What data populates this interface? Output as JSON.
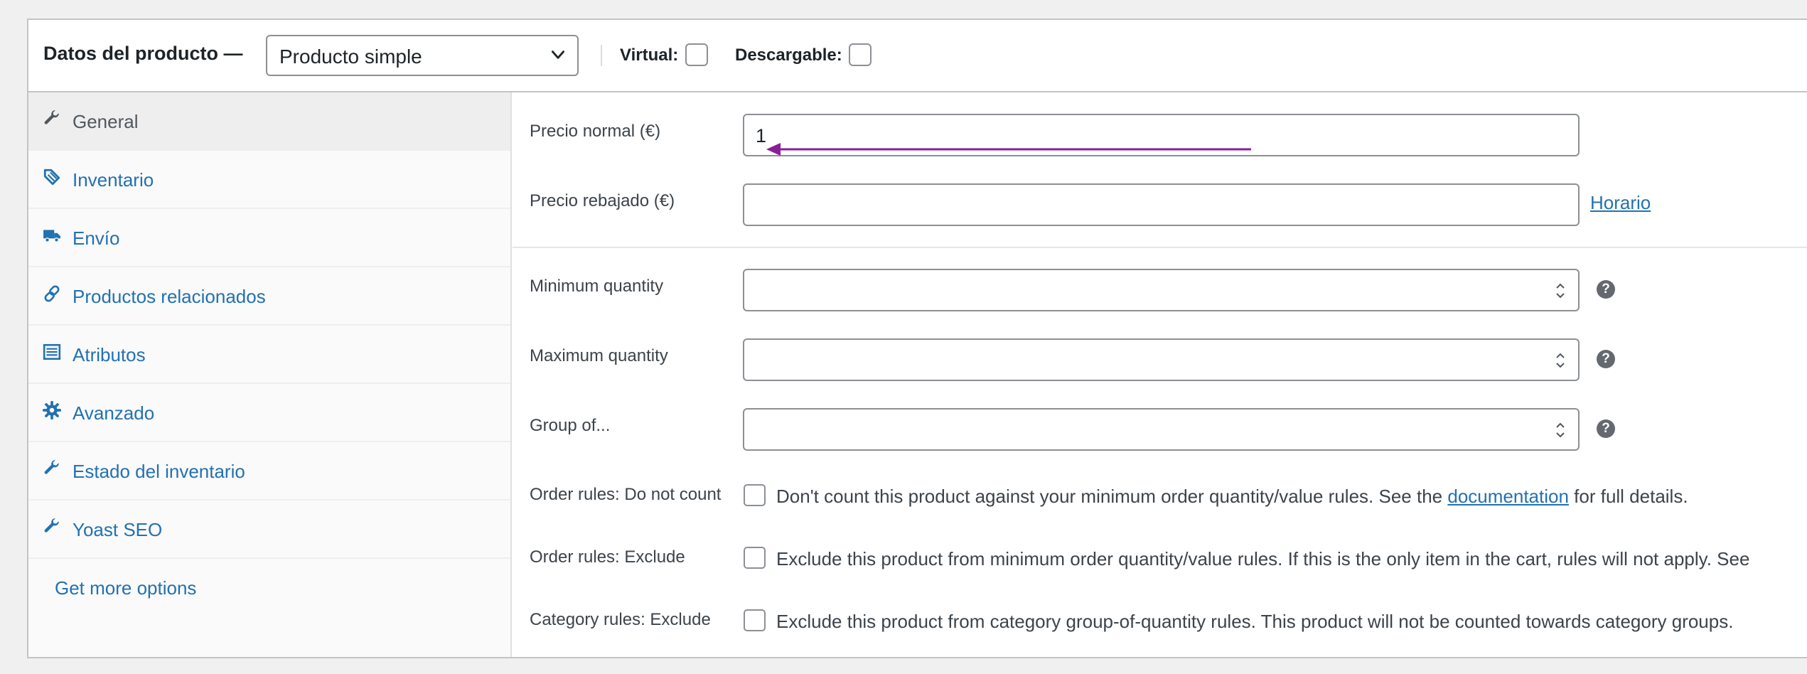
{
  "header": {
    "title": "Datos del producto —",
    "product_type": "Producto simple",
    "virtual_label": "Virtual:",
    "downloadable_label": "Descargable:"
  },
  "sidebar": {
    "items": [
      {
        "label": "General",
        "icon": "wrench-icon",
        "active": true
      },
      {
        "label": "Inventario",
        "icon": "tag-icon"
      },
      {
        "label": "Envío",
        "icon": "truck-icon"
      },
      {
        "label": "Productos relacionados",
        "icon": "link-icon"
      },
      {
        "label": "Atributos",
        "icon": "list-icon"
      },
      {
        "label": "Avanzado",
        "icon": "gear-icon"
      },
      {
        "label": "Estado del inventario",
        "icon": "wrench-icon"
      },
      {
        "label": "Yoast SEO",
        "icon": "wrench-icon"
      }
    ],
    "more_options": "Get more options"
  },
  "pricing": {
    "regular_price_label": "Precio normal (€)",
    "regular_price_value": "1",
    "sale_price_label": "Precio rebajado (€)",
    "sale_price_value": "",
    "schedule_link": "Horario"
  },
  "quantity": {
    "min_label": "Minimum quantity",
    "max_label": "Maximum quantity",
    "group_label": "Group of...",
    "help_glyph": "?"
  },
  "rules": {
    "do_not_count_label": "Order rules: Do not count",
    "do_not_count_text_before": "Don't count this product against your minimum order quantity/value rules. See the",
    "do_not_count_link": "documentation",
    "do_not_count_text_after": "for full details.",
    "exclude_label": "Order rules: Exclude",
    "exclude_text": "Exclude this product from minimum order quantity/value rules. If this is the only item in the cart, rules will not apply. See",
    "category_exclude_label": "Category rules: Exclude",
    "category_exclude_text": "Exclude this product from category group-of-quantity rules. This product will not be counted towards category groups."
  },
  "colors": {
    "link": "#2271b1",
    "annotation_arrow": "#8b1d9b"
  }
}
